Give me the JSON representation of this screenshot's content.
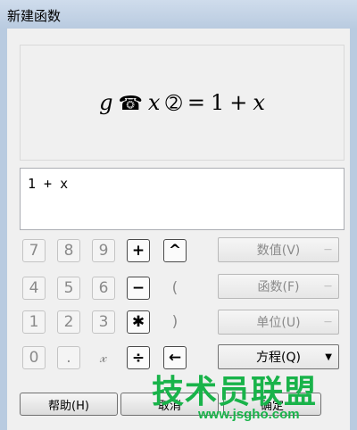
{
  "window": {
    "title": "新建函数"
  },
  "preview": {
    "f_name": "g",
    "open_sym": "☎",
    "var": "x",
    "close_sym": "➁",
    "equals": "=",
    "rhs_const": "1",
    "plus": "+",
    "rhs_var": "x"
  },
  "editor": {
    "value": "1 + x"
  },
  "keypad": [
    [
      "7",
      "8",
      "9",
      "+",
      "^"
    ],
    [
      "4",
      "5",
      "6",
      "−",
      "("
    ],
    [
      "1",
      "2",
      "3",
      "✱",
      ")"
    ],
    [
      "0",
      ".",
      "𝓍",
      "÷",
      "←"
    ]
  ],
  "menus": [
    {
      "label": "数值(V)",
      "arrow": "—"
    },
    {
      "label": "函数(F)",
      "arrow": "—"
    },
    {
      "label": "单位(U)",
      "arrow": "—"
    },
    {
      "label": "方程(Q)",
      "arrow": "▼"
    }
  ],
  "dialog_buttons": {
    "help": "帮助(H)",
    "cancel": "取消",
    "ok": "确定"
  },
  "watermark": {
    "text": "技术员联盟",
    "url": "www.jsgho.com"
  }
}
